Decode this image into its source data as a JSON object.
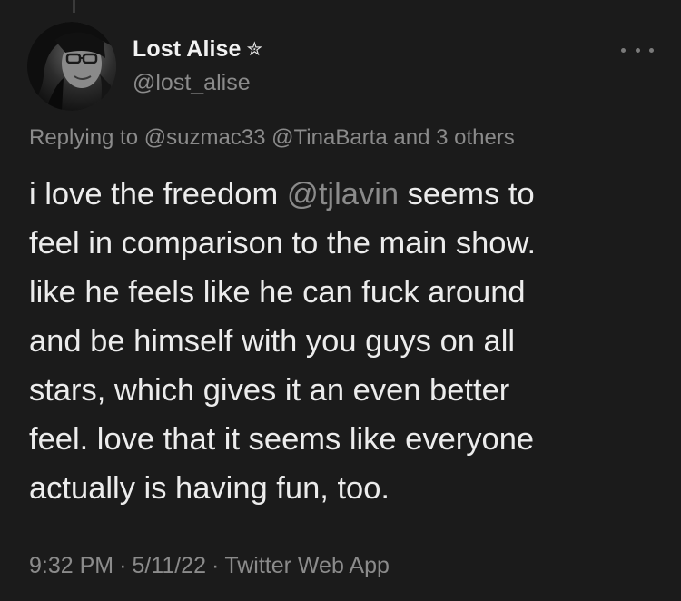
{
  "author": {
    "display_name": "Lost Alise",
    "badge": "✮",
    "handle": "@lost_alise"
  },
  "reply_context": {
    "prefix": "Replying to",
    "mentions": [
      "@suzmac33",
      "@TinaBarta"
    ],
    "others": "and 3 others"
  },
  "tweet": {
    "line1_before": "i love the freedom",
    "line1_mention": "@tjlavin",
    "line1_after": "seems to",
    "line2": "feel in comparison to the main show.",
    "line3": "like he feels like he can fuck around",
    "line4": "and be himself with you guys on all",
    "line5": "stars, which gives it an even better",
    "line6": "feel. love that it seems like everyone",
    "line7": "actually is having fun, too."
  },
  "meta": {
    "time": "9:32 PM",
    "separator": "·",
    "date": "5/11/22",
    "source": "Twitter Web App"
  },
  "icons": {
    "more": "more-horizontal-icon",
    "badge": "star-icon"
  },
  "colors": {
    "background": "#1b1b1b",
    "text": "#ececec",
    "secondary": "#8b8b8b"
  }
}
